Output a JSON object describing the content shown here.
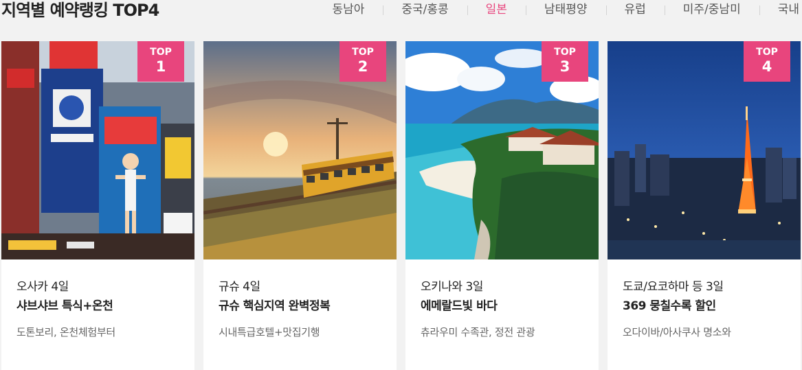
{
  "header": {
    "title": "지역별 예약랭킹 TOP4",
    "tabs": [
      {
        "label": "동남아",
        "active": false
      },
      {
        "label": "중국/홍콩",
        "active": false
      },
      {
        "label": "일본",
        "active": true
      },
      {
        "label": "남태평양",
        "active": false
      },
      {
        "label": "유럽",
        "active": false
      },
      {
        "label": "미주/중남미",
        "active": false
      },
      {
        "label": "국내",
        "active": false
      }
    ]
  },
  "colors": {
    "accent": "#e8457d",
    "background": "#f2f2f2"
  },
  "cards": [
    {
      "badge_top": "TOP",
      "badge_num": "1",
      "line1": "오사카 4일",
      "line2": "샤브샤브 특식+온천",
      "sub": "도톤보리, 온천체험부터"
    },
    {
      "badge_top": "TOP",
      "badge_num": "2",
      "line1": "규슈 4일",
      "line2": "규슈 핵심지역 완벽정복",
      "sub": "시내특급호텔+맛집기행"
    },
    {
      "badge_top": "TOP",
      "badge_num": "3",
      "line1": "오키나와 3일",
      "line2": "에메랄드빛 바다",
      "sub": "츄라우미 수족관, 정전 관광"
    },
    {
      "badge_top": "TOP",
      "badge_num": "4",
      "line1": "도쿄/요코하마 등 3일",
      "line2": "369 뭉칠수록 할인",
      "sub": "오다이바/아사쿠사 명소와"
    }
  ]
}
